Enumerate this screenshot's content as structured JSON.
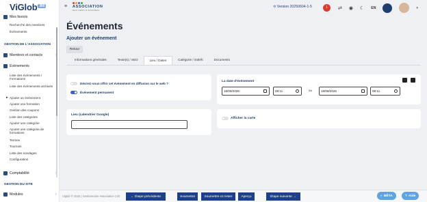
{
  "brand": {
    "logo_text": "ViGlob",
    "logo_tag": "360"
  },
  "sidebar": {
    "favoris": "Mes favoris",
    "favoris_items": [
      "Recherche des membres",
      "Événements"
    ],
    "section_association": "GESTION DE L'ASSOCIATION",
    "membres": "Membres et contacts",
    "evenements": "Événements",
    "event_items": [
      "Liste des événements / Formations",
      "Liste des événements archivés",
      "Ajouter un événement",
      "Ajouter une formation",
      "Gestion des coupons",
      "Liste des catégories",
      "Ajouter une catégorie",
      "Ajouter une catégorie de formations",
      "Termes",
      "Tournois",
      "Liste des sondages",
      "Configuration"
    ],
    "comptabilite": "Comptabilité",
    "section_site": "GESTION DU SITE",
    "modules": "Modules"
  },
  "topbar": {
    "assoc_name": "ASSOCIATION",
    "assoc_sub": "DES GENS D'AFFAIRES",
    "version": "Version 20250604-1-5",
    "notif_count": "1",
    "lang": "EN"
  },
  "page": {
    "title": "Événements",
    "subtitle": "Ajouter un événement",
    "back": "Retour"
  },
  "tabs": [
    "Informations générales",
    "Texte(s) / SEO",
    "Lieu / Dates",
    "Catégorie / intérêt",
    "Documents"
  ],
  "active_tab": "Lieu / Dates",
  "options": {
    "diffusion": "Désirez-vous offrir cet événement en diffusion sur le web ?",
    "permanent": "Événement permanent"
  },
  "dates": {
    "label": "La date d'événement",
    "start_date": "18/08/2026",
    "start_time": "08:11",
    "sep": "au",
    "end_date": "18/08/2026",
    "end_time": "08:11"
  },
  "lieu": {
    "label": "Lieu (calendrier Google)",
    "value": ""
  },
  "map": {
    "label": "Afficher la carte"
  },
  "footer": {
    "copyright": "Viglob © 2026 | Gestionnaire Association | Dir",
    "prev": "Étape précédente",
    "submit": "Soumettre",
    "submit_stay": "Soumettre et rester",
    "preview": "Aperçu",
    "next": "Étape suivante",
    "beta": "BÊTA",
    "help": "Aide"
  },
  "colors": {
    "accent": "#1e3f8c",
    "brand": "#1d3e6e",
    "notif": "#e03a2f",
    "pill": "#5fa3e0"
  }
}
